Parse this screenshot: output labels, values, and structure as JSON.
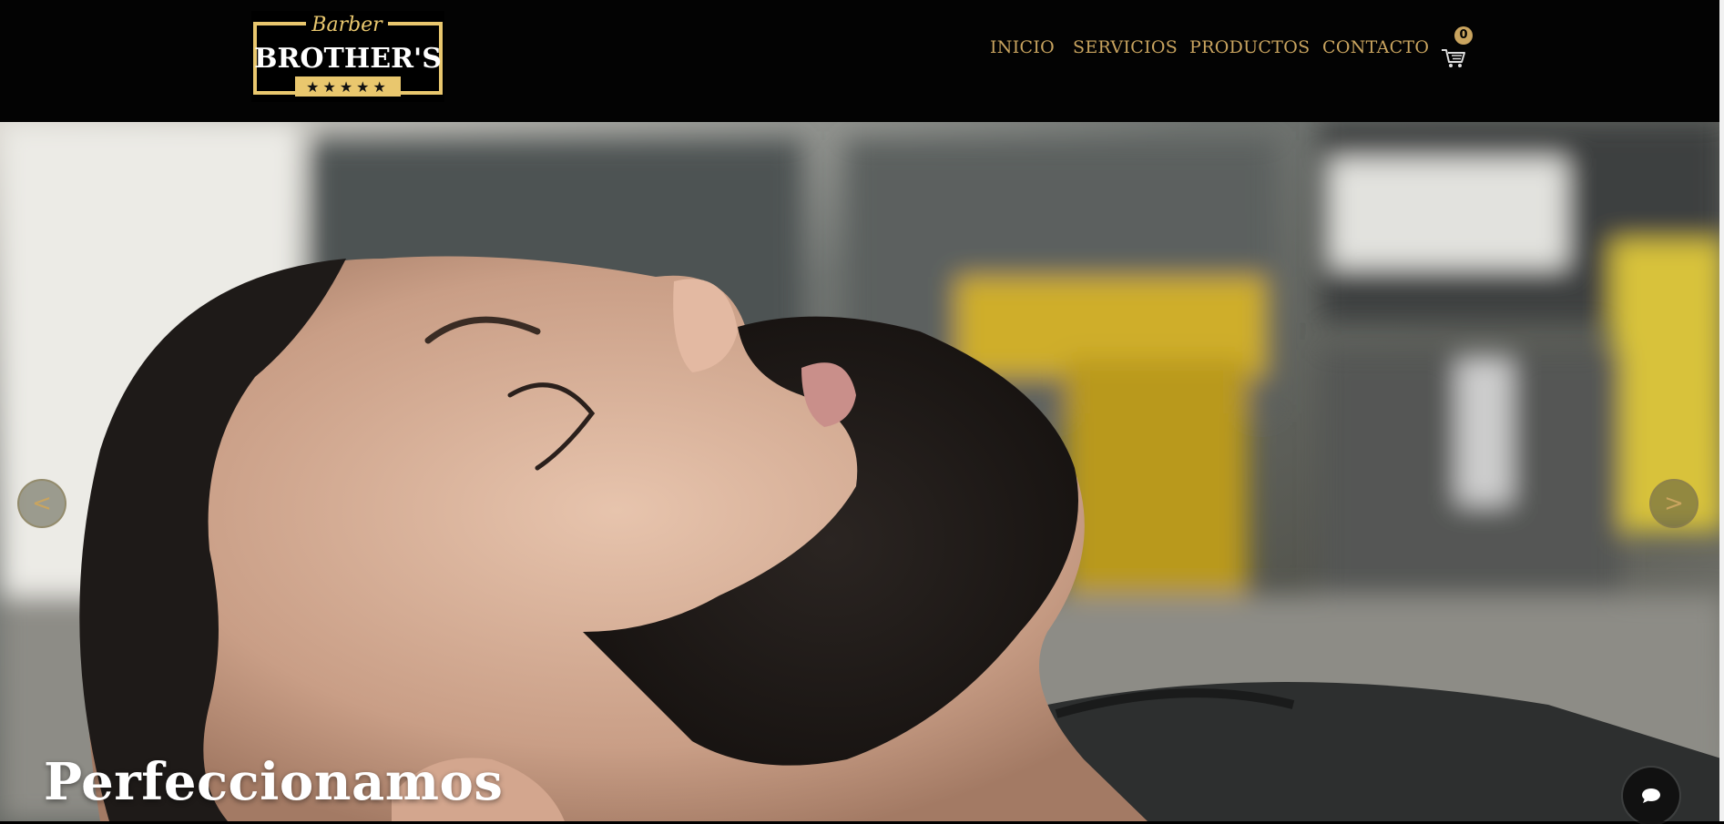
{
  "logo": {
    "script_text": "Barber",
    "brand_text": "BROTHER'S",
    "stars": "★★★★★"
  },
  "nav": {
    "items": [
      {
        "label": "INICIO"
      },
      {
        "label": "SERVICIOS"
      },
      {
        "label": "PRODUCTOS"
      },
      {
        "label": "CONTACTO"
      }
    ]
  },
  "cart": {
    "count": "0",
    "icon": "shopping-cart-icon"
  },
  "hero": {
    "headline": "Perfeccionamos",
    "prev_label": "<",
    "next_label": ">"
  },
  "chat": {
    "icon": "chat-bubble-icon"
  },
  "colors": {
    "gold": "#c9a45f",
    "header_bg": "#030303"
  }
}
